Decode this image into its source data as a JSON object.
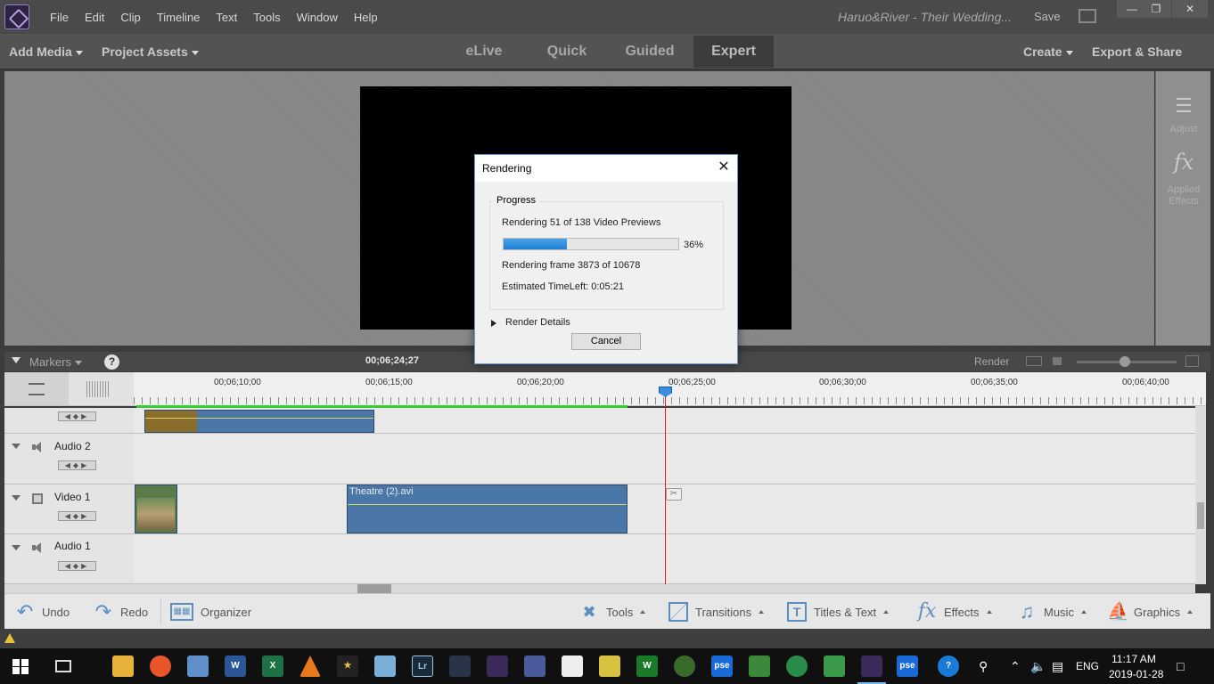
{
  "menubar": {
    "items": [
      "File",
      "Edit",
      "Clip",
      "Timeline",
      "Text",
      "Tools",
      "Window",
      "Help"
    ],
    "doc_title": "Haruo&River - Their Wedding...",
    "save_label": "Save"
  },
  "modebar": {
    "add_media": "Add Media",
    "project_assets": "Project Assets",
    "tabs": [
      "eLive",
      "Quick",
      "Guided",
      "Expert"
    ],
    "active_tab": "Expert",
    "create": "Create",
    "export_share": "Export & Share"
  },
  "right_panel": {
    "adjust_label": "Adjust",
    "applied_effects_label": "Applied Effects"
  },
  "timeline": {
    "markers_label": "Markers",
    "current_time": "00;06;24;27",
    "render_label": "Render",
    "ruler_labels": [
      "00;06;10;00",
      "00;06;15;00",
      "00;06;20;00",
      "00;06;25;00",
      "00;06;30;00",
      "00;06;35;00",
      "00;06;40;00"
    ],
    "tracks": [
      {
        "name": "Audio 2"
      },
      {
        "name": "Video 1"
      },
      {
        "name": "Audio 1"
      }
    ],
    "clip_theatre": "Theatre (2).avi"
  },
  "bottom_bar": {
    "undo": "Undo",
    "redo": "Redo",
    "organizer": "Organizer",
    "tools": "Tools",
    "transitions": "Transitions",
    "titles_text": "Titles & Text",
    "effects": "Effects",
    "music": "Music",
    "graphics": "Graphics"
  },
  "dialog": {
    "title": "Rendering",
    "group_label": "Progress",
    "previews_text": "Rendering 51 of 138 Video Previews",
    "progress_percent_text": "36%",
    "progress_value": 0.36,
    "frame_text": "Rendering frame 3873 of 10678",
    "time_left_text": "Estimated TimeLeft:  0:05:21",
    "render_details": "Render Details",
    "cancel_label": "Cancel"
  },
  "taskbar": {
    "language": "ENG",
    "time": "11:17 AM",
    "date": "2019-01-28"
  },
  "colors": {
    "accent": "#4a76a8",
    "progress": "#2a8ae0",
    "render_bar": "#33cc33",
    "playhead": "#e02020"
  }
}
